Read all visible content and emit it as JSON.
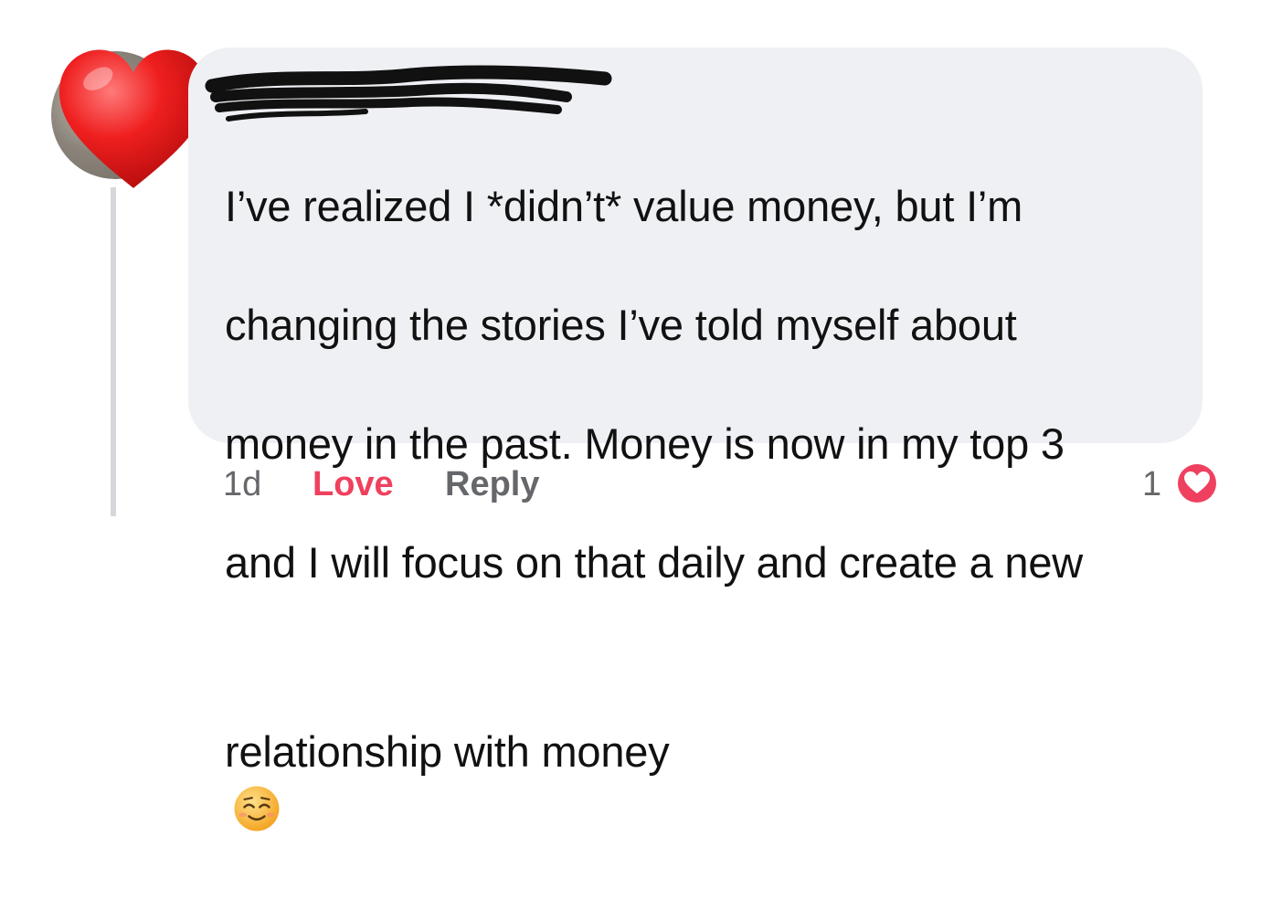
{
  "comment": {
    "author_name_redacted": "",
    "lines": [
      "I’ve realized I *didn’t* value money, but I’m",
      "changing the stories I’ve told myself about",
      "money in the past. Money is now in my top 3",
      "and I will focus on that daily and create a new",
      "relationship with money"
    ],
    "emoji": "relieved-face-emoji",
    "sticker": "red-heart-icon"
  },
  "meta": {
    "timestamp": "1d",
    "love_label": "Love",
    "reply_label": "Reply",
    "reaction_count": "1",
    "reaction_icon": "love-reaction-icon"
  },
  "colors": {
    "bubble_bg": "#eff0f4",
    "love_red": "#f0405f",
    "meta_gray": "#65676b",
    "text": "#111111"
  }
}
